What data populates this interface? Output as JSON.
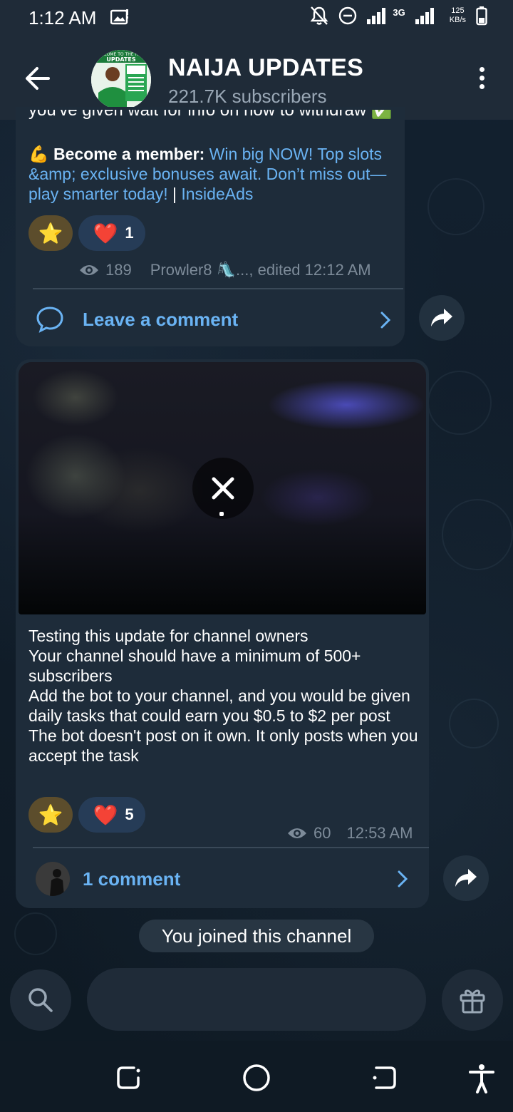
{
  "status_bar": {
    "time": "1:12 AM",
    "network_1": "3G",
    "speed_value": "125",
    "speed_unit": "KB/s",
    "icons": [
      "image-icon",
      "bell-off-icon",
      "dnd-icon",
      "signal-icon",
      "signal-icon",
      "battery-icon"
    ]
  },
  "header": {
    "channel_name": "NAIJA UPDATES",
    "subscribers": "221.7K subscribers",
    "avatar_text_top": "WELCOME TO THE HOME",
    "avatar_text_main": "UPDATES",
    "avatar_badge": "NAIJA UPDATES"
  },
  "post1": {
    "clipped_text": "you've given wait for info on how to withdraw ✅",
    "promo_emoji": "💪",
    "promo_label": "Become a member:",
    "promo_link": "Win big NOW! Top slots &amp; exclusive bonuses await. Don’t miss out—play smarter today!",
    "promo_sep": " | ",
    "promo_source": "InsideAds",
    "reaction_star": "⭐",
    "reaction_heart": "❤️",
    "heart_count": "1",
    "views": "189",
    "author": "Prowler8 🛝...",
    "edited": ", edited 12:12 AM",
    "comment_label": "Leave a comment"
  },
  "post2": {
    "lines": [
      "Testing this update for channel owners",
      "Your channel should have a minimum of 500+ subscribers",
      "Add the bot to your channel, and you would be given daily tasks that could earn you $0.5 to $2 per post",
      "The bot doesn't post on it own. It only posts when you accept the task"
    ],
    "reaction_star": "⭐",
    "reaction_heart": "❤️",
    "heart_count": "5",
    "views": "60",
    "time": "12:53 AM",
    "comment_label": "1 comment"
  },
  "service_message": "You joined this channel",
  "colors": {
    "accent": "#6ab3f3",
    "bubble": "#1e2c3a",
    "header": "#1f2b38",
    "meta": "#7d8b99"
  }
}
